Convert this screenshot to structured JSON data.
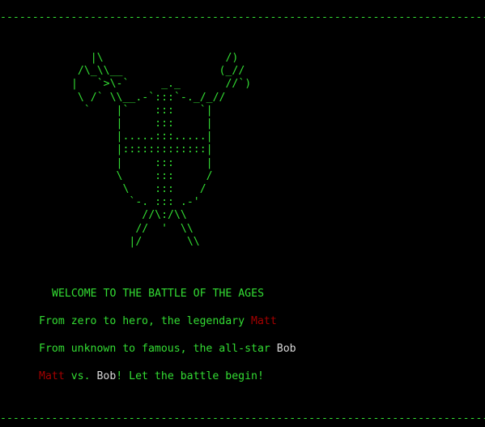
{
  "colors": {
    "background": "#000000",
    "text_green": "#33dd33",
    "name_red": "#a40000",
    "name_white": "#d8d8d8"
  },
  "divider": "------------------------------------------------------------------------------------------",
  "ascii_art": "    |\\                   /)\n  /\\_\\\\__               (_//\n |   `>\\-`     _._       //`)\n  \\ /` \\\\__.-`:::`-._/_//\n   `    |`    :::    `|\n        |     :::     |\n        |.....:::.....|\n        |:::::::::::::|\n        |     :::     |\n        \\     :::     /\n         \\    :::    /\n          `-. ::: .-'\n            //\\:/\\\\\n           //  '  \\\\\n          |/       \\\\",
  "welcome": "WELCOME TO THE BATTLE OF THE AGES",
  "line2": {
    "prefix": "From zero to hero, the legendary ",
    "name": "Matt"
  },
  "line3": {
    "prefix": "From unknown to famous, the all-star ",
    "name": "Bob"
  },
  "line4": {
    "name1": "Matt",
    "vs": " vs. ",
    "name2": "Bob",
    "suffix": "! Let the battle begin!"
  }
}
